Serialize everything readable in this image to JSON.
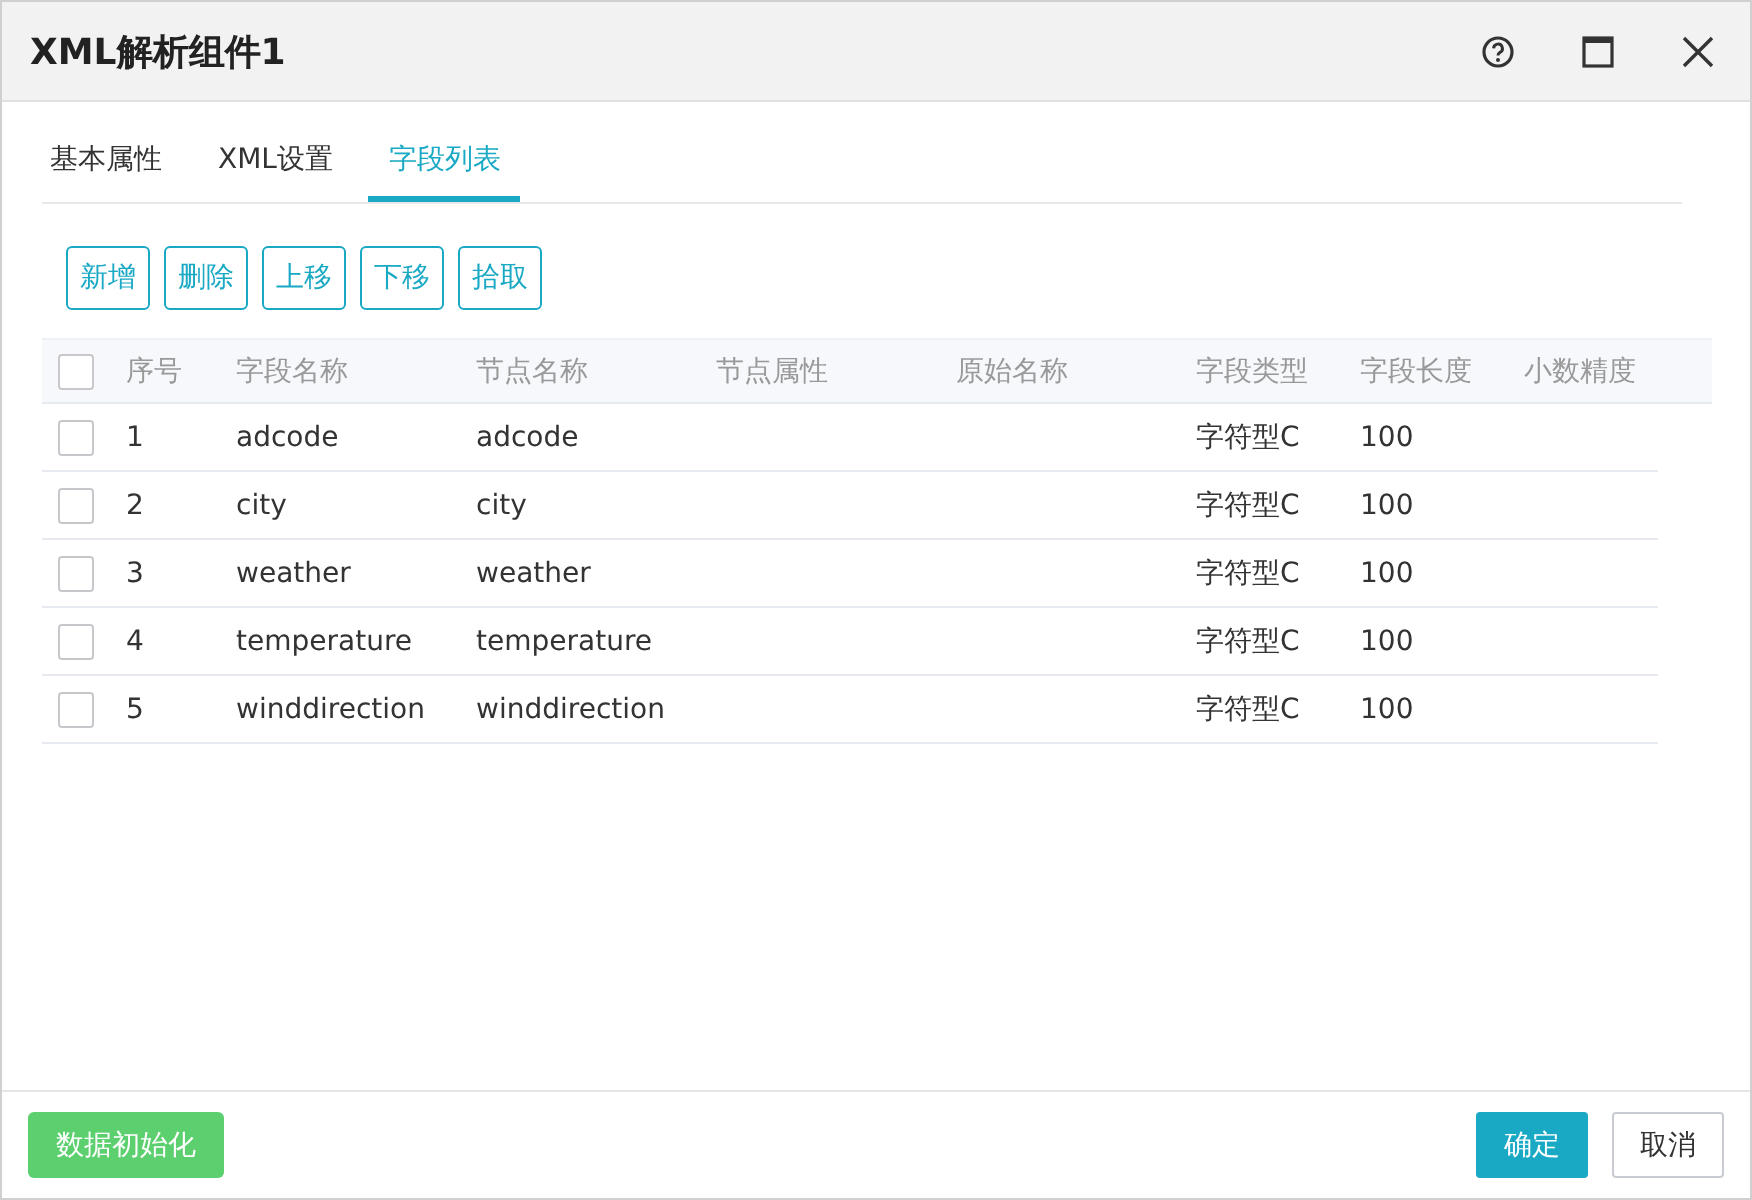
{
  "window": {
    "title": "XML解析组件1",
    "buttons": [
      {
        "kind": "help"
      },
      {
        "kind": "maximize"
      },
      {
        "kind": "close"
      }
    ]
  },
  "tabs": [
    {
      "label": "基本属性",
      "selected": false
    },
    {
      "label": "XML设置",
      "selected": false
    },
    {
      "label": "字段列表",
      "selected": true
    }
  ],
  "toolbar": [
    "新增",
    "删除",
    "上移",
    "下移",
    "拾取"
  ],
  "table": {
    "header_checked": false,
    "columns": [
      "序号",
      "字段名称",
      "节点名称",
      "节点属性",
      "原始名称",
      "字段类型",
      "字段长度",
      "小数精度"
    ],
    "rows": [
      {
        "checked": false,
        "cells": [
          "1",
          "adcode",
          "adcode",
          "",
          "",
          "字符型C",
          "100",
          ""
        ]
      },
      {
        "checked": false,
        "cells": [
          "2",
          "city",
          "city",
          "",
          "",
          "字符型C",
          "100",
          ""
        ]
      },
      {
        "checked": false,
        "cells": [
          "3",
          "weather",
          "weather",
          "",
          "",
          "字符型C",
          "100",
          ""
        ]
      },
      {
        "checked": false,
        "cells": [
          "4",
          "temperature",
          "temperature",
          "",
          "",
          "字符型C",
          "100",
          ""
        ]
      },
      {
        "checked": false,
        "cells": [
          "5",
          "winddirection",
          "winddirection",
          "",
          "",
          "字符型C",
          "100",
          ""
        ]
      }
    ]
  },
  "footer": {
    "init_button": "数据初始化",
    "ok_button": "确定",
    "cancel_button": "取消"
  }
}
